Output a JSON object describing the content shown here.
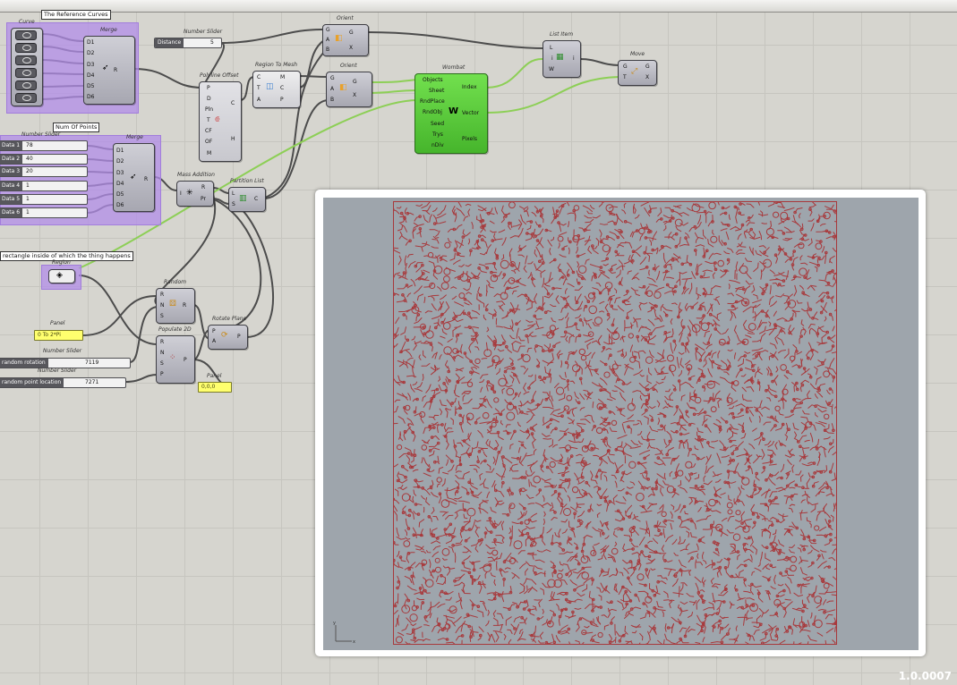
{
  "groups": {
    "curves_caption": "The Reference Curves",
    "num_points_caption": "Num Of Points",
    "region_caption": "rectangle inside of which the thing happens"
  },
  "curve_param": {
    "label": "Curve"
  },
  "merge1": {
    "title": "Merge",
    "inputs": [
      "D1",
      "D2",
      "D3",
      "D4",
      "D5",
      "D6"
    ],
    "output": "R"
  },
  "merge2": {
    "title": "Merge",
    "inputs": [
      "D1",
      "D2",
      "D3",
      "D4",
      "D5",
      "D6"
    ],
    "output": "R"
  },
  "distance_slider": {
    "title": "Number Slider",
    "name": "Distance",
    "value": "5"
  },
  "data_sliders": {
    "title": "Number Slider",
    "items": [
      {
        "name": "Data 1",
        "value": "78"
      },
      {
        "name": "Data 2",
        "value": "40"
      },
      {
        "name": "Data 3",
        "value": "20"
      },
      {
        "name": "Data 4",
        "value": "1"
      },
      {
        "name": "Data 5",
        "value": "1"
      },
      {
        "name": "Data 6",
        "value": "1"
      }
    ]
  },
  "polyline_offset": {
    "title": "Polyline Offset",
    "inputs": [
      "P",
      "D",
      "Pln",
      "T",
      "CF",
      "OF",
      "M"
    ],
    "outputs": [
      "C",
      "H"
    ]
  },
  "region_to_mesh": {
    "title": "Region To Mesh",
    "inputs": [
      "C",
      "T",
      "A"
    ],
    "outputs": [
      "M",
      "C",
      "P"
    ]
  },
  "orient1": {
    "title": "Orient",
    "inputs": [
      "G",
      "A",
      "B"
    ],
    "outputs": [
      "G",
      "X"
    ]
  },
  "orient2": {
    "title": "Orient",
    "inputs": [
      "G",
      "A",
      "B"
    ],
    "outputs": [
      "G",
      "X"
    ]
  },
  "wombat": {
    "title": "Wombat",
    "inputs": [
      "Objects",
      "Sheet",
      "RndPlace",
      "RndObj",
      "Seed",
      "Trys",
      "nDiv"
    ],
    "outputs": [
      "Index",
      "Vector",
      "Pixels"
    ]
  },
  "list_item": {
    "title": "List Item",
    "inputs": [
      "L",
      "i",
      "W"
    ],
    "outputs": [
      "i"
    ]
  },
  "move": {
    "title": "Move",
    "inputs": [
      "G",
      "T"
    ],
    "outputs": [
      "G",
      "X"
    ]
  },
  "mass_addition": {
    "title": "Mass Addition",
    "inputs": [
      "I"
    ],
    "outputs": [
      "R",
      "Pr"
    ]
  },
  "partition_list": {
    "title": "Partition List",
    "inputs": [
      "L",
      "S"
    ],
    "outputs": [
      "C"
    ]
  },
  "region_param": {
    "label": "Region"
  },
  "random": {
    "title": "Random",
    "inputs": [
      "R",
      "N",
      "S"
    ],
    "outputs": [
      "R"
    ]
  },
  "populate2d": {
    "title": "Populate 2D",
    "inputs": [
      "R",
      "N",
      "S",
      "P"
    ],
    "outputs": [
      "P"
    ]
  },
  "rotate_plane": {
    "title": "Rotate Plane",
    "inputs": [
      "P",
      "A"
    ],
    "outputs": [
      "P"
    ]
  },
  "panel1": {
    "title": "Panel",
    "text": "0 To 2*Pi"
  },
  "panel2": {
    "title": "Panel",
    "text": "0,0,0"
  },
  "rot_slider": {
    "title": "Number Slider",
    "name": "random rotation",
    "value": "7119"
  },
  "pt_slider": {
    "title": "Number Slider",
    "name": "random point location",
    "value": "7271"
  },
  "viewport": {
    "axis_y": "y",
    "axis_x": "x"
  },
  "version": "1.0.0007",
  "colors": {
    "canvas": "#d6d5cf",
    "group": "#b28ce8",
    "wombat": "#52c236",
    "wire_green": "#8dcf56",
    "pattern": "#a8393c"
  }
}
